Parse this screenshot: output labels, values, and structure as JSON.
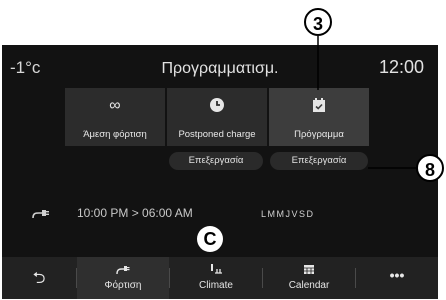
{
  "header": {
    "temperature": "-1°c",
    "title": "Προγραμματισμ.",
    "time": "12:00"
  },
  "modes": [
    {
      "label": "Άμεση φόρτιση",
      "icon": "infinity-icon"
    },
    {
      "label": "Postponed charge",
      "icon": "clock-icon"
    },
    {
      "label": "Πρόγραμμα",
      "icon": "calendar-check-icon"
    }
  ],
  "edit_buttons": [
    "Επεξεργασία",
    "Επεξεργασία"
  ],
  "schedule": {
    "time_range": "10:00 PM > 06:00 AM",
    "days": "LMMJVSD",
    "icon": "charging-plug-icon"
  },
  "nav": [
    {
      "label": "",
      "icon": "back-arrow-icon"
    },
    {
      "label": "Φόρτιση",
      "icon": "charging-plug-icon"
    },
    {
      "label": "Climate",
      "icon": "climate-icon"
    },
    {
      "label": "Calendar",
      "icon": "calendar-icon"
    },
    {
      "label": "",
      "icon": "more-icon"
    }
  ],
  "annotations": {
    "callout_3": "3",
    "callout_8": "8",
    "marker_c": "C"
  }
}
